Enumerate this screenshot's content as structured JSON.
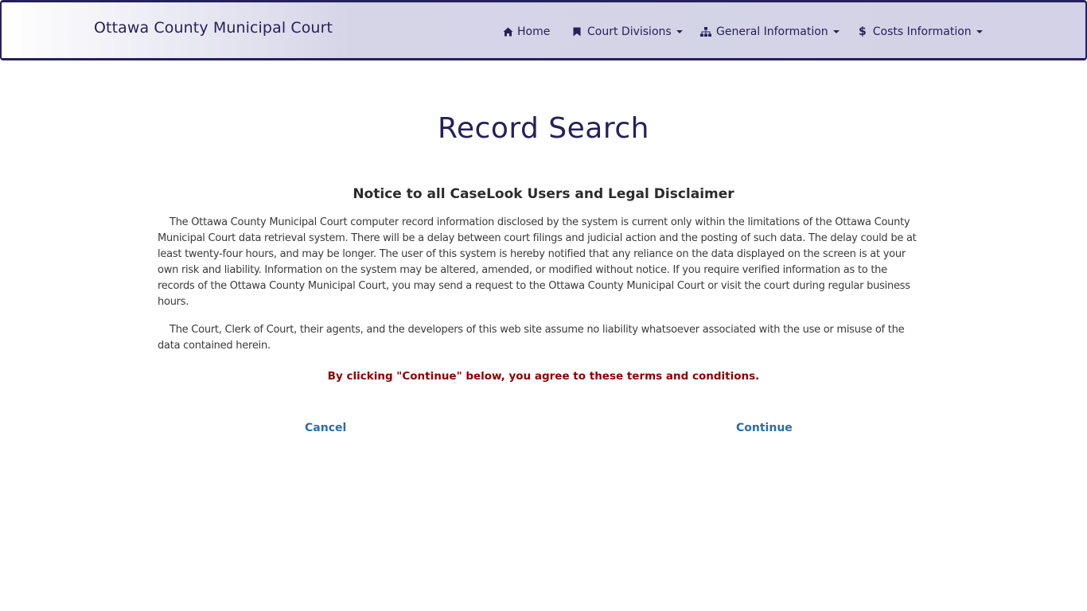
{
  "navbar": {
    "brand": "Ottawa County Municipal Court",
    "items": [
      {
        "label": "Home",
        "icon": "home-icon"
      },
      {
        "label": "Court Divisions",
        "icon": "bookmark-icon"
      },
      {
        "label": "General Information",
        "icon": "sitemap-icon"
      },
      {
        "label": "Costs Information",
        "icon": "dollar-icon"
      }
    ]
  },
  "main": {
    "title": "Record Search",
    "notice_heading": "Notice to all CaseLook Users and Legal Disclaimer",
    "paragraphs": [
      "The Ottawa County Municipal Court computer record information disclosed by the system is current only within the limitations of the Ottawa County Municipal Court data retrieval system. There will be a delay between court filings and judicial action and the posting of such data. The delay could be at least twenty-four hours, and may be longer. The user of this system is hereby notified that any reliance on the data displayed on the screen is at your own risk and liability. Information on the system may be altered, amended, or modified without notice. If you require verified information as to the records of the Ottawa County Municipal Court, you may send a request to the Ottawa County Municipal Court or visit the court during regular business hours.",
      "The Court, Clerk of Court, their agents, and the developers of this web site assume no liability whatsoever associated with the use or misuse of the data contained herein."
    ],
    "agreement": "By clicking \"Continue\" below, you agree to these terms and conditions.",
    "cancel_label": "Cancel",
    "continue_label": "Continue"
  },
  "colors": {
    "navy": "#26215a",
    "warning_red": "#8b0000",
    "link_blue": "#2e6da4"
  }
}
